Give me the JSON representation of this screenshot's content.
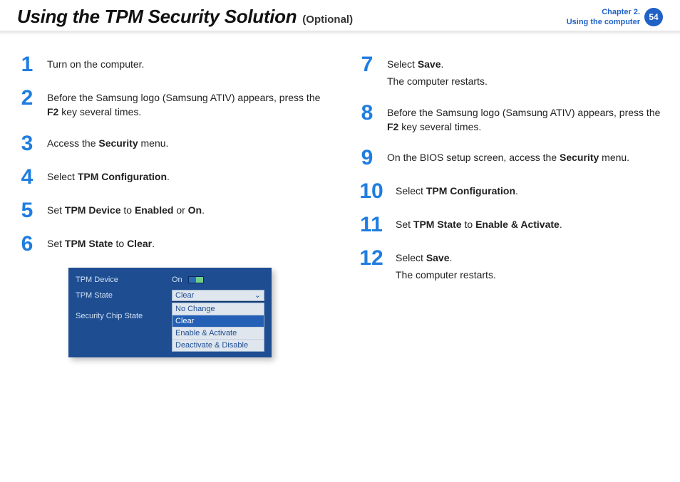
{
  "header": {
    "title": "Using the TPM Security Solution",
    "optional": "(Optional)",
    "chapter_line1": "Chapter 2.",
    "chapter_line2": "Using the computer",
    "page_number": "54"
  },
  "left_steps": [
    {
      "num": "1",
      "segments": [
        {
          "t": "Turn on the computer."
        }
      ]
    },
    {
      "num": "2",
      "segments": [
        {
          "t": "Before the Samsung logo (Samsung ATIV) appears, press the "
        },
        {
          "t": "F2",
          "b": true
        },
        {
          "t": " key several times."
        }
      ]
    },
    {
      "num": "3",
      "segments": [
        {
          "t": "Access the "
        },
        {
          "t": "Security",
          "b": true
        },
        {
          "t": " menu."
        }
      ]
    },
    {
      "num": "4",
      "segments": [
        {
          "t": "Select "
        },
        {
          "t": "TPM Conﬁguration",
          "b": true
        },
        {
          "t": "."
        }
      ]
    },
    {
      "num": "5",
      "segments": [
        {
          "t": "Set "
        },
        {
          "t": "TPM Device",
          "b": true
        },
        {
          "t": " to "
        },
        {
          "t": "Enabled",
          "b": true
        },
        {
          "t": " or "
        },
        {
          "t": "On",
          "b": true
        },
        {
          "t": "."
        }
      ]
    },
    {
      "num": "6",
      "segments": [
        {
          "t": "Set "
        },
        {
          "t": "TPM State",
          "b": true
        },
        {
          "t": " to "
        },
        {
          "t": "Clear",
          "b": true
        },
        {
          "t": "."
        }
      ]
    }
  ],
  "right_steps": [
    {
      "num": "7",
      "segments": [
        {
          "t": "Select "
        },
        {
          "t": "Save",
          "b": true
        },
        {
          "t": "."
        }
      ],
      "sub": "The computer restarts."
    },
    {
      "num": "8",
      "segments": [
        {
          "t": "Before the Samsung logo (Samsung ATIV) appears, press the "
        },
        {
          "t": "F2",
          "b": true
        },
        {
          "t": " key several times."
        }
      ]
    },
    {
      "num": "9",
      "segments": [
        {
          "t": "On the BIOS setup screen, access the "
        },
        {
          "t": "Security",
          "b": true
        },
        {
          "t": " menu."
        }
      ]
    },
    {
      "num": "10",
      "wide": true,
      "segments": [
        {
          "t": "Select "
        },
        {
          "t": "TPM Conﬁguration",
          "b": true
        },
        {
          "t": "."
        }
      ]
    },
    {
      "num": "11",
      "wide": true,
      "segments": [
        {
          "t": "Set "
        },
        {
          "t": "TPM State",
          "b": true
        },
        {
          "t": " to "
        },
        {
          "t": "Enable & Activate",
          "b": true
        },
        {
          "t": "."
        }
      ]
    },
    {
      "num": "12",
      "wide": true,
      "segments": [
        {
          "t": "Select "
        },
        {
          "t": "Save",
          "b": true
        },
        {
          "t": "."
        }
      ],
      "sub": "The computer restarts."
    }
  ],
  "bios": {
    "rows": {
      "tpm_device_label": "TPM Device",
      "tpm_device_value": "On",
      "tpm_state_label": "TPM State",
      "tpm_state_value": "Clear",
      "security_chip_label": "Security Chip State"
    },
    "options": [
      "No Change",
      "Clear",
      "Enable & Activate",
      "Deactivate & Disable"
    ],
    "selected_option": "Clear"
  }
}
